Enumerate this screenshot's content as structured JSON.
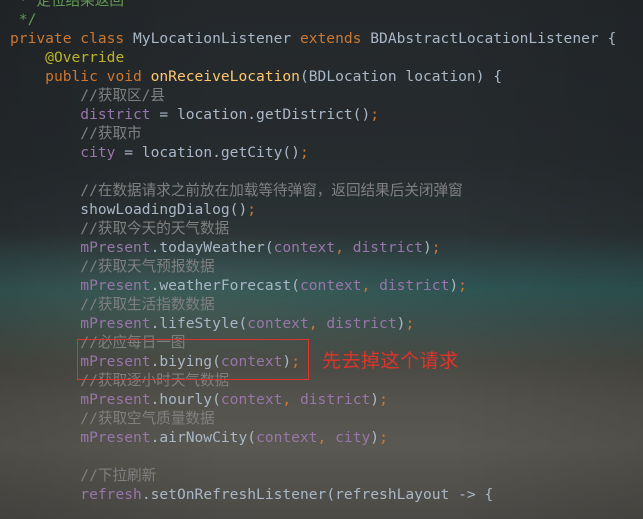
{
  "code_lines": [
    {
      "parts": [
        {
          "c": "cmt-doc",
          "t": " * 定位结果返回"
        }
      ]
    },
    {
      "parts": [
        {
          "c": "cmt-doc",
          "t": " */"
        }
      ]
    },
    {
      "parts": [
        {
          "c": "kw",
          "t": "private class "
        },
        {
          "c": "plain",
          "t": "MyLocationListener "
        },
        {
          "c": "kw",
          "t": "extends "
        },
        {
          "c": "plain",
          "t": "BDAbstractLocationListener {"
        }
      ]
    },
    {
      "parts": [
        {
          "c": "plain",
          "t": "    "
        },
        {
          "c": "ann",
          "t": "@Override"
        }
      ]
    },
    {
      "parts": [
        {
          "c": "plain",
          "t": "    "
        },
        {
          "c": "kw",
          "t": "public void "
        },
        {
          "c": "fn",
          "t": "onReceiveLocation"
        },
        {
          "c": "plain",
          "t": "(BDLocation location) {"
        }
      ]
    },
    {
      "parts": [
        {
          "c": "plain",
          "t": "        "
        },
        {
          "c": "cmt",
          "t": "//获取区/县"
        }
      ]
    },
    {
      "parts": [
        {
          "c": "plain",
          "t": "        "
        },
        {
          "c": "fld",
          "t": "district"
        },
        {
          "c": "plain",
          "t": " = location.getDistrict()"
        },
        {
          "c": "kw",
          "t": ";"
        }
      ]
    },
    {
      "parts": [
        {
          "c": "plain",
          "t": "        "
        },
        {
          "c": "cmt",
          "t": "//获取市"
        }
      ]
    },
    {
      "parts": [
        {
          "c": "plain",
          "t": "        "
        },
        {
          "c": "fld",
          "t": "city"
        },
        {
          "c": "plain",
          "t": " = location.getCity()"
        },
        {
          "c": "kw",
          "t": ";"
        }
      ]
    },
    {
      "parts": [
        {
          "c": "plain",
          "t": ""
        }
      ]
    },
    {
      "parts": [
        {
          "c": "plain",
          "t": "        "
        },
        {
          "c": "cmt",
          "t": "//在数据请求之前放在加载等待弹窗，返回结果后关闭弹窗"
        }
      ]
    },
    {
      "parts": [
        {
          "c": "plain",
          "t": "        showLoadingDialog()"
        },
        {
          "c": "kw",
          "t": ";"
        }
      ]
    },
    {
      "parts": [
        {
          "c": "plain",
          "t": "        "
        },
        {
          "c": "cmt",
          "t": "//获取今天的天气数据"
        }
      ]
    },
    {
      "parts": [
        {
          "c": "plain",
          "t": "        "
        },
        {
          "c": "fld",
          "t": "mPresent"
        },
        {
          "c": "plain",
          "t": ".todayWeather("
        },
        {
          "c": "fld",
          "t": "context"
        },
        {
          "c": "kw",
          "t": ", "
        },
        {
          "c": "fld",
          "t": "district"
        },
        {
          "c": "plain",
          "t": ")"
        },
        {
          "c": "kw",
          "t": ";"
        }
      ]
    },
    {
      "parts": [
        {
          "c": "plain",
          "t": "        "
        },
        {
          "c": "cmt",
          "t": "//获取天气预报数据"
        }
      ]
    },
    {
      "parts": [
        {
          "c": "plain",
          "t": "        "
        },
        {
          "c": "fld",
          "t": "mPresent"
        },
        {
          "c": "plain",
          "t": ".weatherForecast("
        },
        {
          "c": "fld",
          "t": "context"
        },
        {
          "c": "kw",
          "t": ", "
        },
        {
          "c": "fld",
          "t": "district"
        },
        {
          "c": "plain",
          "t": ")"
        },
        {
          "c": "kw",
          "t": ";"
        }
      ]
    },
    {
      "parts": [
        {
          "c": "plain",
          "t": "        "
        },
        {
          "c": "cmt",
          "t": "//获取生活指数数据"
        }
      ]
    },
    {
      "parts": [
        {
          "c": "plain",
          "t": "        "
        },
        {
          "c": "fld",
          "t": "mPresent"
        },
        {
          "c": "plain",
          "t": ".lifeStyle("
        },
        {
          "c": "fld",
          "t": "context"
        },
        {
          "c": "kw",
          "t": ", "
        },
        {
          "c": "fld",
          "t": "district"
        },
        {
          "c": "plain",
          "t": ")"
        },
        {
          "c": "kw",
          "t": ";"
        }
      ]
    },
    {
      "parts": [
        {
          "c": "plain",
          "t": "        "
        },
        {
          "c": "cmt",
          "t": "//必应每日一图"
        }
      ]
    },
    {
      "parts": [
        {
          "c": "plain",
          "t": "        "
        },
        {
          "c": "fld",
          "t": "mPresent"
        },
        {
          "c": "plain",
          "t": ".biying("
        },
        {
          "c": "fld",
          "t": "context"
        },
        {
          "c": "plain",
          "t": ")"
        },
        {
          "c": "kw",
          "t": ";"
        }
      ]
    },
    {
      "parts": [
        {
          "c": "plain",
          "t": "        "
        },
        {
          "c": "cmt",
          "t": "//获取逐小时天气数据"
        }
      ]
    },
    {
      "parts": [
        {
          "c": "plain",
          "t": "        "
        },
        {
          "c": "fld",
          "t": "mPresent"
        },
        {
          "c": "plain",
          "t": ".hourly("
        },
        {
          "c": "fld",
          "t": "context"
        },
        {
          "c": "kw",
          "t": ", "
        },
        {
          "c": "fld",
          "t": "district"
        },
        {
          "c": "plain",
          "t": ")"
        },
        {
          "c": "kw",
          "t": ";"
        }
      ]
    },
    {
      "parts": [
        {
          "c": "plain",
          "t": "        "
        },
        {
          "c": "cmt",
          "t": "//获取空气质量数据"
        }
      ]
    },
    {
      "parts": [
        {
          "c": "plain",
          "t": "        "
        },
        {
          "c": "fld",
          "t": "mPresent"
        },
        {
          "c": "plain",
          "t": ".airNowCity("
        },
        {
          "c": "fld",
          "t": "context"
        },
        {
          "c": "kw",
          "t": ", "
        },
        {
          "c": "fld",
          "t": "city"
        },
        {
          "c": "plain",
          "t": ")"
        },
        {
          "c": "kw",
          "t": ";"
        }
      ]
    },
    {
      "parts": [
        {
          "c": "plain",
          "t": ""
        }
      ]
    },
    {
      "parts": [
        {
          "c": "plain",
          "t": "        "
        },
        {
          "c": "cmt",
          "t": "//下拉刷新"
        }
      ]
    },
    {
      "parts": [
        {
          "c": "plain",
          "t": "        "
        },
        {
          "c": "fld",
          "t": "refresh"
        },
        {
          "c": "plain",
          "t": ".setOnRefreshListener(refreshLayout -> {"
        }
      ]
    }
  ],
  "annotation": {
    "text": "先去掉这个请求",
    "color": "#e0342a"
  },
  "syntax_colors": {
    "keyword": "#cc7832",
    "comment": "#808080",
    "doc_comment": "#629755",
    "field": "#9876aa",
    "method": "#ffc66d",
    "annotation": "#bbb529",
    "text": "#a9b7c6"
  }
}
